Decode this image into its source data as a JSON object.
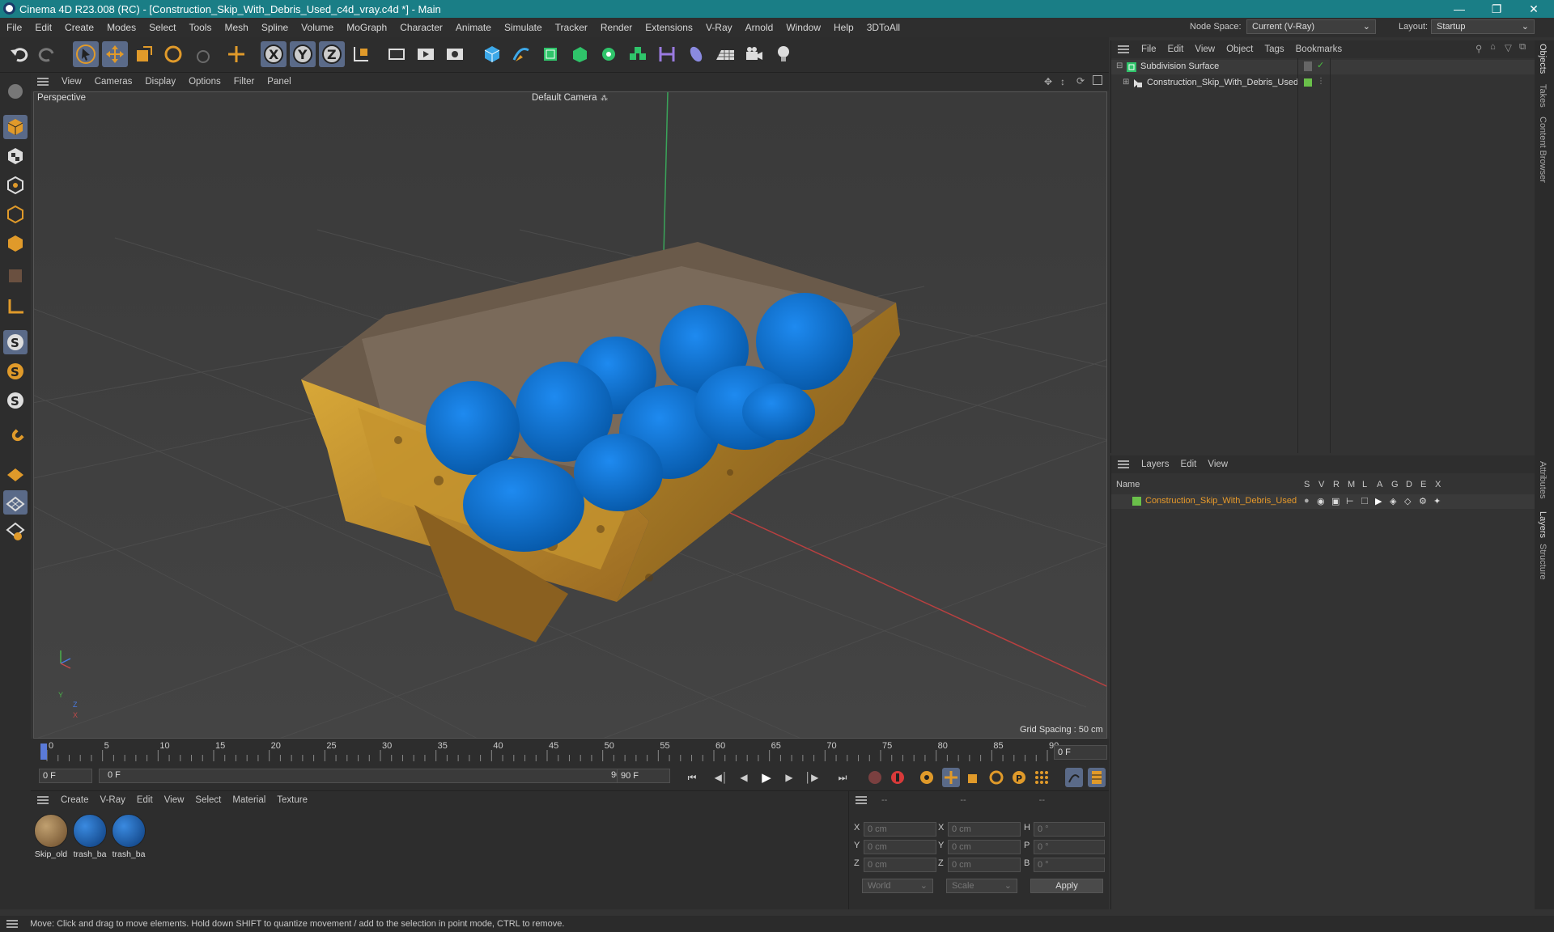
{
  "titlebar": {
    "title": "Cinema 4D R23.008 (RC) - [Construction_Skip_With_Debris_Used_c4d_vray.c4d *] - Main",
    "minimize": "—",
    "restore": "❐",
    "close": "✕"
  },
  "menu": [
    "File",
    "Edit",
    "Create",
    "Modes",
    "Select",
    "Tools",
    "Mesh",
    "Spline",
    "Volume",
    "MoGraph",
    "Character",
    "Animate",
    "Simulate",
    "Tracker",
    "Render",
    "Extensions",
    "V-Ray",
    "Arnold",
    "Window",
    "Help",
    "3DToAll"
  ],
  "nodespace": {
    "label": "Node Space:",
    "value": "Current (V-Ray)"
  },
  "layout": {
    "label": "Layout:",
    "value": "Startup"
  },
  "viewport": {
    "menu": [
      "View",
      "Cameras",
      "Display",
      "Options",
      "Filter",
      "Panel"
    ],
    "name": "Perspective",
    "camera": "Default Camera",
    "grid_spacing": "Grid Spacing : 50 cm",
    "axis": {
      "y": "Y",
      "z": "Z",
      "x": "X"
    }
  },
  "timeline": {
    "ticks": [
      "0",
      "5",
      "10",
      "15",
      "20",
      "25",
      "30",
      "35",
      "40",
      "45",
      "50",
      "55",
      "60",
      "65",
      "70",
      "75",
      "80",
      "85",
      "90"
    ],
    "current_frame": "0 F",
    "start_field": "0 F",
    "range_start": "0 F",
    "range_end": "90 F",
    "end_field": "90 F"
  },
  "materials": {
    "menu": [
      "Create",
      "V-Ray",
      "Edit",
      "View",
      "Select",
      "Material",
      "Texture"
    ],
    "items": [
      {
        "name": "Skip_old",
        "color": "#8a6a40"
      },
      {
        "name": "trash_ba",
        "color": "#1f5fa8"
      },
      {
        "name": "trash_ba",
        "color": "#1f5fa8"
      }
    ]
  },
  "coords": {
    "headers": [
      "--",
      "--",
      "--"
    ],
    "rows": [
      {
        "a": "X",
        "av": "0 cm",
        "b": "X",
        "bv": "0 cm",
        "c": "H",
        "cv": "0 °"
      },
      {
        "a": "Y",
        "av": "0 cm",
        "b": "Y",
        "bv": "0 cm",
        "c": "P",
        "cv": "0 °"
      },
      {
        "a": "Z",
        "av": "0 cm",
        "b": "Z",
        "bv": "0 cm",
        "c": "B",
        "cv": "0 °"
      }
    ],
    "world": "World",
    "scale": "Scale",
    "apply": "Apply"
  },
  "objects": {
    "menu": [
      "File",
      "Edit",
      "View",
      "Object",
      "Tags",
      "Bookmarks"
    ],
    "items": [
      {
        "name": "Subdivision Surface"
      },
      {
        "name": "Construction_Skip_With_Debris_Used"
      }
    ]
  },
  "layers": {
    "menu": [
      "Layers",
      "Edit",
      "View"
    ],
    "col_name": "Name",
    "cols": [
      "S",
      "V",
      "R",
      "M",
      "L",
      "A",
      "G",
      "D",
      "E",
      "X"
    ],
    "item": "Construction_Skip_With_Debris_Used",
    "item_color": "#e89a2a"
  },
  "side_tabs": [
    "Objects",
    "Takes",
    "Content Browser",
    "Attributes",
    "Layers",
    "Structure"
  ],
  "status": "Move: Click and drag to move elements. Hold down SHIFT to quantize movement / add to the selection in point mode, CTRL to remove.",
  "colors": {
    "titlebar": "#1a7e86",
    "bag": "#0a6fd6",
    "skip": "#c99a2e",
    "accent": "#5a6a88"
  }
}
